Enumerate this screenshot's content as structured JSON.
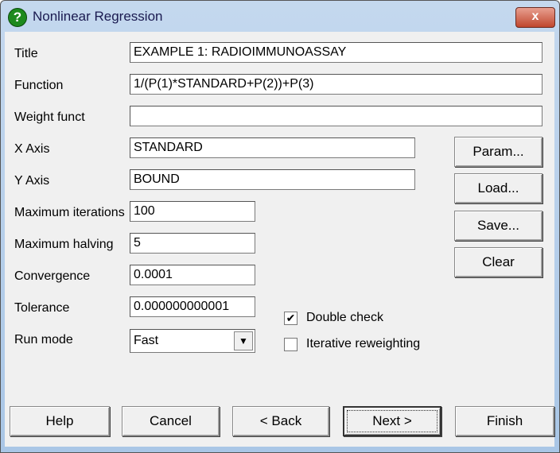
{
  "window": {
    "title": "Nonlinear Regression",
    "close_label": "x"
  },
  "fields": {
    "title": {
      "label": "Title",
      "value": "EXAMPLE 1: RADIOIMMUNOASSAY"
    },
    "function": {
      "label": "Function",
      "value": "1/(P(1)*STANDARD+P(2))+P(3)"
    },
    "weight": {
      "label": "Weight funct",
      "value": ""
    },
    "x_axis": {
      "label": "X Axis",
      "value": "STANDARD"
    },
    "y_axis": {
      "label": "Y Axis",
      "value": "BOUND"
    },
    "max_iter": {
      "label": "Maximum iterations",
      "value": "100"
    },
    "max_halving": {
      "label": "Maximum halving",
      "value": "5"
    },
    "convergence": {
      "label": "Convergence",
      "value": "0.0001"
    },
    "tolerance": {
      "label": "Tolerance",
      "value": "0.000000000001"
    },
    "run_mode": {
      "label": "Run mode",
      "value": "Fast"
    }
  },
  "checkboxes": {
    "double_check": {
      "label": "Double check",
      "checked": true,
      "mark": "✔"
    },
    "iterative": {
      "label": "Iterative reweighting",
      "checked": false
    }
  },
  "side_buttons": {
    "param": "Param...",
    "load": "Load...",
    "save": "Save...",
    "clear": "Clear"
  },
  "bottom_buttons": {
    "help": "Help",
    "cancel": "Cancel",
    "back": "< Back",
    "next": "Next >",
    "finish": "Finish"
  }
}
